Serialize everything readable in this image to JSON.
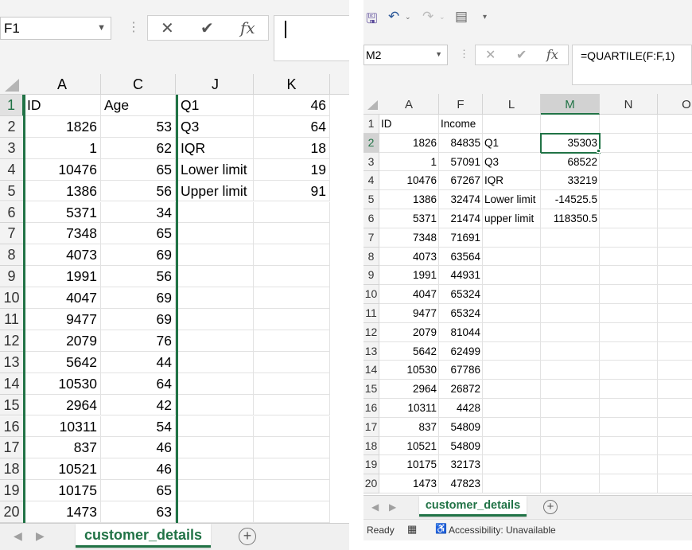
{
  "left": {
    "name_box": "F1",
    "formula_buttons": {
      "cancel": "✕",
      "enter": "✔",
      "fx": "fx"
    },
    "formula_value": "",
    "columns": [
      "A",
      "C",
      "J",
      "K"
    ],
    "rows": [
      [
        "1",
        "ID",
        "Age",
        "Q1",
        "46"
      ],
      [
        "2",
        "1826",
        "53",
        "Q3",
        "64"
      ],
      [
        "3",
        "1",
        "62",
        "IQR",
        "18"
      ],
      [
        "4",
        "10476",
        "65",
        "Lower limit",
        "19"
      ],
      [
        "5",
        "1386",
        "56",
        "Upper limit",
        "91"
      ],
      [
        "6",
        "5371",
        "34",
        "",
        ""
      ],
      [
        "7",
        "7348",
        "65",
        "",
        ""
      ],
      [
        "8",
        "4073",
        "69",
        "",
        ""
      ],
      [
        "9",
        "1991",
        "56",
        "",
        ""
      ],
      [
        "10",
        "4047",
        "69",
        "",
        ""
      ],
      [
        "11",
        "9477",
        "69",
        "",
        ""
      ],
      [
        "12",
        "2079",
        "76",
        "",
        ""
      ],
      [
        "13",
        "5642",
        "44",
        "",
        ""
      ],
      [
        "14",
        "10530",
        "64",
        "",
        ""
      ],
      [
        "15",
        "2964",
        "42",
        "",
        ""
      ],
      [
        "16",
        "10311",
        "54",
        "",
        ""
      ],
      [
        "17",
        "837",
        "46",
        "",
        ""
      ],
      [
        "18",
        "10521",
        "46",
        "",
        ""
      ],
      [
        "19",
        "10175",
        "65",
        "",
        ""
      ],
      [
        "20",
        "1473",
        "63",
        "",
        ""
      ]
    ],
    "sheet_tab": "customer_details",
    "add_sheet": "+"
  },
  "right": {
    "quick_access": {
      "save": "save-icon",
      "undo": "undo-icon",
      "redo": "redo-icon",
      "form": "form-icon"
    },
    "name_box": "M2",
    "formula_buttons": {
      "cancel": "✕",
      "enter": "✔",
      "fx": "fx"
    },
    "formula_value": "=QUARTILE(F:F,1)",
    "columns": [
      "A",
      "F",
      "L",
      "M",
      "N",
      "O"
    ],
    "rows": [
      [
        "1",
        "ID",
        "Income",
        "",
        ""
      ],
      [
        "2",
        "1826",
        "84835",
        "Q1",
        "35303"
      ],
      [
        "3",
        "1",
        "57091",
        "Q3",
        "68522"
      ],
      [
        "4",
        "10476",
        "67267",
        "IQR",
        "33219"
      ],
      [
        "5",
        "1386",
        "32474",
        "Lower limit",
        "-14525.5"
      ],
      [
        "6",
        "5371",
        "21474",
        "upper limit",
        "118350.5"
      ],
      [
        "7",
        "7348",
        "71691",
        "",
        ""
      ],
      [
        "8",
        "4073",
        "63564",
        "",
        ""
      ],
      [
        "9",
        "1991",
        "44931",
        "",
        ""
      ],
      [
        "10",
        "4047",
        "65324",
        "",
        ""
      ],
      [
        "11",
        "9477",
        "65324",
        "",
        ""
      ],
      [
        "12",
        "2079",
        "81044",
        "",
        ""
      ],
      [
        "13",
        "5642",
        "62499",
        "",
        ""
      ],
      [
        "14",
        "10530",
        "67786",
        "",
        ""
      ],
      [
        "15",
        "2964",
        "26872",
        "",
        ""
      ],
      [
        "16",
        "10311",
        "4428",
        "",
        ""
      ],
      [
        "17",
        "837",
        "54809",
        "",
        ""
      ],
      [
        "18",
        "10521",
        "54809",
        "",
        ""
      ],
      [
        "19",
        "10175",
        "32173",
        "",
        ""
      ],
      [
        "20",
        "1473",
        "47823",
        "",
        ""
      ]
    ],
    "sheet_tab": "customer_details",
    "add_sheet": "+",
    "status": {
      "ready": "Ready",
      "accessibility": "Accessibility: Unavailable"
    }
  },
  "colors": {
    "excel_green": "#217346",
    "header_gray": "#f3f3f3"
  }
}
